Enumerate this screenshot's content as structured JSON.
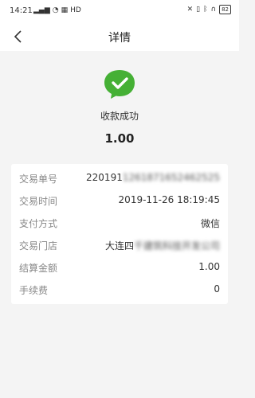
{
  "status_bar": {
    "time": "14:21",
    "network": "HD",
    "battery": "82"
  },
  "nav": {
    "title": "详情",
    "back_icon": "chevron-left-icon"
  },
  "success": {
    "icon": "wechat-check-icon",
    "status_text": "收款成功",
    "amount": "1.00",
    "brand_color": "#45b035"
  },
  "details": [
    {
      "label": "交易单号",
      "value": "220191",
      "value_blurred": "1261871652462525"
    },
    {
      "label": "交易时间",
      "value": "2019-11-26 18:19:45"
    },
    {
      "label": "支付方式",
      "value": "微信"
    },
    {
      "label": "交易门店",
      "value": "大连四",
      "value_blurred": "千建筑科技开发公司"
    },
    {
      "label": "结算金额",
      "value": "1.00"
    },
    {
      "label": "手续费",
      "value": "0"
    }
  ]
}
